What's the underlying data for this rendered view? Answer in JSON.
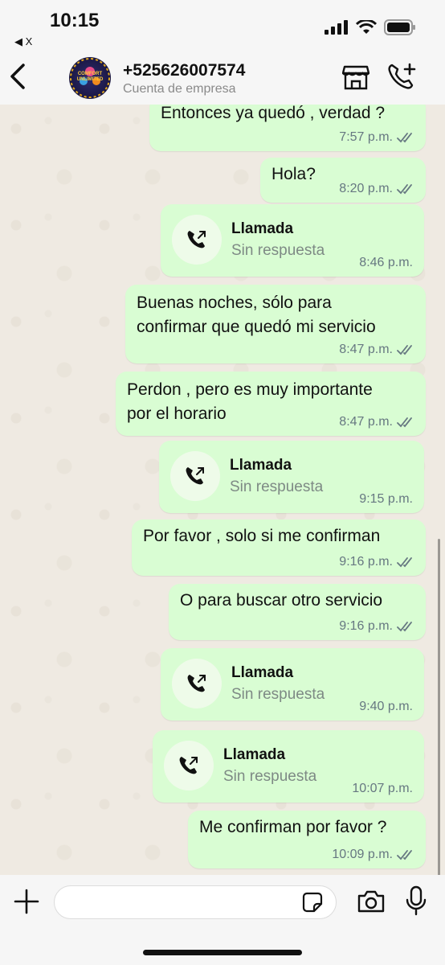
{
  "status_bar": {
    "time": "10:15",
    "back_app": "◀ X"
  },
  "header": {
    "title": "+525626007574",
    "subtitle": "Cuenta de empresa",
    "avatar_text": "COMFORT UNLIMITED"
  },
  "messages": [
    {
      "type": "text",
      "lines": [
        "Entonces ya quedó , verdad ?"
      ],
      "time": "7:57 p.m."
    },
    {
      "type": "text",
      "lines": [
        "Hola?"
      ],
      "time": "8:20 p.m."
    },
    {
      "type": "call",
      "title": "Llamada",
      "subtitle": "Sin respuesta",
      "time": "8:46 p.m."
    },
    {
      "type": "text",
      "lines": [
        "Buenas noches, sólo para",
        "confirmar que quedó mi servicio"
      ],
      "time": "8:47 p.m."
    },
    {
      "type": "text",
      "lines": [
        "Perdon , pero es muy importante",
        "por el horario"
      ],
      "time": "8:47 p.m."
    },
    {
      "type": "call",
      "title": "Llamada",
      "subtitle": "Sin respuesta",
      "time": "9:15 p.m."
    },
    {
      "type": "text",
      "lines": [
        "Por favor , solo si me confirman"
      ],
      "time": "9:16 p.m."
    },
    {
      "type": "text",
      "lines": [
        "O para buscar otro servicio"
      ],
      "time": "9:16 p.m."
    },
    {
      "type": "call",
      "title": "Llamada",
      "subtitle": "Sin respuesta",
      "time": "9:40 p.m."
    },
    {
      "type": "call",
      "title": "Llamada",
      "subtitle": "Sin respuesta",
      "time": "10:07 p.m."
    },
    {
      "type": "text",
      "lines": [
        "Me confirman por favor ?"
      ],
      "time": "10:09 p.m."
    }
  ],
  "input": {
    "placeholder": ""
  },
  "colors": {
    "bubble": "#d9fdd3",
    "ticks": "#667781",
    "chat_bg": "#efeae2"
  },
  "icons": [
    "back-chevron-icon",
    "store-icon",
    "call-add-icon",
    "phone-outgoing-icon",
    "plus-icon",
    "sticker-icon",
    "camera-icon",
    "mic-icon",
    "double-check-icon"
  ]
}
